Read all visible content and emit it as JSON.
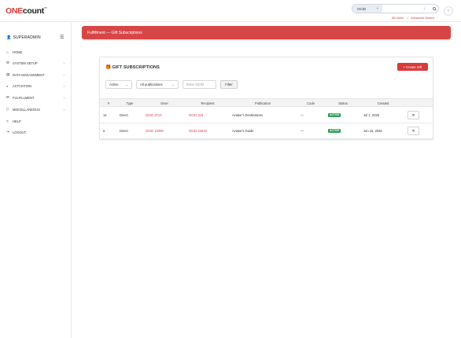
{
  "brand": {
    "one": "ONE",
    "count": "count",
    "tm": "™"
  },
  "search": {
    "scope": "OCID",
    "shortcut": "/"
  },
  "top_links": {
    "all_users": "All Users",
    "account_search": "Advanced Search"
  },
  "sidebar": {
    "user": "SUPERADMIN",
    "items": [
      {
        "label": "HOME",
        "icon": "home-icon",
        "glyph": "⌂",
        "has_arrow": false
      },
      {
        "label": "SYSTEM SETUP",
        "icon": "gear-icon",
        "glyph": "⚙",
        "has_arrow": true
      },
      {
        "label": "DATA MANAGEMENT",
        "icon": "database-icon",
        "glyph": "▤",
        "has_arrow": true
      },
      {
        "label": "ACTIVATION",
        "icon": "toggle-icon",
        "glyph": "◐",
        "has_arrow": true
      },
      {
        "label": "FULFILLMENT",
        "icon": "envelope-icon",
        "glyph": "✉",
        "has_arrow": true
      },
      {
        "label": "MISCELLANEOUS",
        "icon": "file-icon",
        "glyph": "▯",
        "has_arrow": true
      },
      {
        "label": "HELP",
        "icon": "question-icon",
        "glyph": "?",
        "has_arrow": false
      },
      {
        "label": "LOGOUT",
        "icon": "logout-icon",
        "glyph": "⇥",
        "has_arrow": false
      }
    ]
  },
  "header": {
    "title": "Fulfillment — Gift Subscriptions"
  },
  "card": {
    "title": "GIFT SUBSCRIPTIONS",
    "create_label": "+ Create Gift",
    "filters": {
      "status": "Active",
      "publication": "All publications",
      "ocid_placeholder": "Enter OCID",
      "button": "Filter"
    },
    "columns": [
      "#",
      "Type",
      "Giver",
      "Recipient",
      "Publication",
      "Code",
      "Status",
      "Created"
    ],
    "rows": [
      {
        "id": "14",
        "type": "Direct",
        "giver": "OCID 3713",
        "recipient": "OCID 344",
        "publication": "Aviator's Destinations",
        "code": "—",
        "status": "ACTIVE",
        "created": "Jul 1, 2026"
      },
      {
        "id": "6",
        "type": "Direct",
        "giver": "OCID 12090",
        "recipient": "OCID 42643",
        "publication": "Aviator's Guide",
        "code": "—",
        "status": "ACTIVE",
        "created": "Jun 15, 2026"
      }
    ]
  },
  "colors": {
    "accent": "#d93a3a",
    "header_bg": "#d64646",
    "status_active": "#2e9e57"
  }
}
